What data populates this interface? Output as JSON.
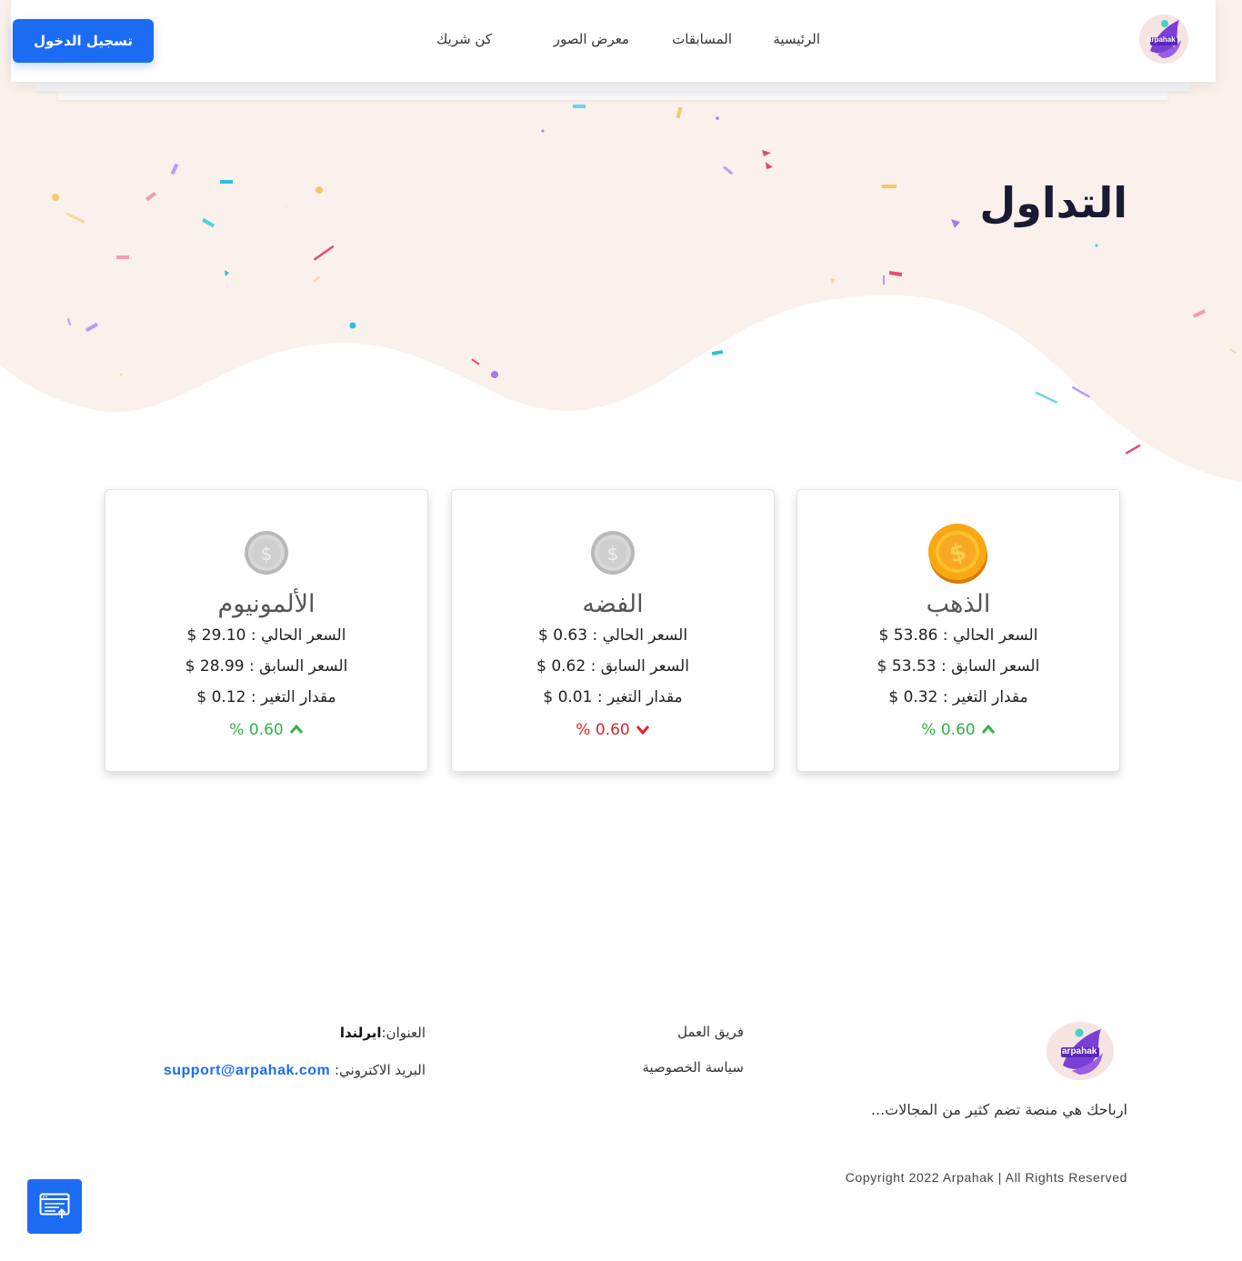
{
  "header": {
    "logo_text": "arpahak",
    "nav": [
      {
        "label": "الرئيسية"
      },
      {
        "label": "المسابقات"
      },
      {
        "label": "معرض الصور"
      },
      {
        "label": "كن شريك"
      }
    ],
    "login_label": "تسجيل الدخول"
  },
  "hero": {
    "title": "التداول"
  },
  "cards": [
    {
      "coin_icon": "gold-coin-icon",
      "title": "الذهب",
      "current": "السعر الحالي : 53.86 $",
      "previous": "السعر السابق : 53.53 $",
      "change": "مقدار التغير : 0.32 $",
      "percent": "0.60 %",
      "direction": "up",
      "percent_color": "#2fb344"
    },
    {
      "coin_icon": "silver-coin-icon",
      "title": "الفضه",
      "current": "السعر الحالي : 0.63 $",
      "previous": "السعر السابق : 0.62 $",
      "change": "مقدار التغير : 0.01 $",
      "percent": "0.60 %",
      "direction": "down",
      "percent_color": "#d9252a"
    },
    {
      "coin_icon": "silver-coin-icon",
      "title": "الألمونيوم",
      "current": "السعر الحالي : 29.10 $",
      "previous": "السعر السابق : 28.99 $",
      "change": "مقدار التغير : 0.12 $",
      "percent": "0.60 %",
      "direction": "up",
      "percent_color": "#2fb344"
    }
  ],
  "footer": {
    "logo_text": "arpahak",
    "about": "ارباحك هي منصة تضم كثير من المجالات...",
    "links": [
      {
        "label": "فريق العمل"
      },
      {
        "label": "سياسة الخصوصية"
      }
    ],
    "address_label": "العنوان:",
    "address_value": "ايرلندا",
    "email_label": "البريد الاكتروني:",
    "email_value": "support@arpahak.com",
    "copyright": "Copyright 2022 Arpahak | All Rights Reserved"
  },
  "colors": {
    "accent": "#1c6cf3",
    "hero_bg": "#faf1ec",
    "title": "#1b1a33",
    "up": "#2fb344",
    "down": "#d9252a"
  }
}
